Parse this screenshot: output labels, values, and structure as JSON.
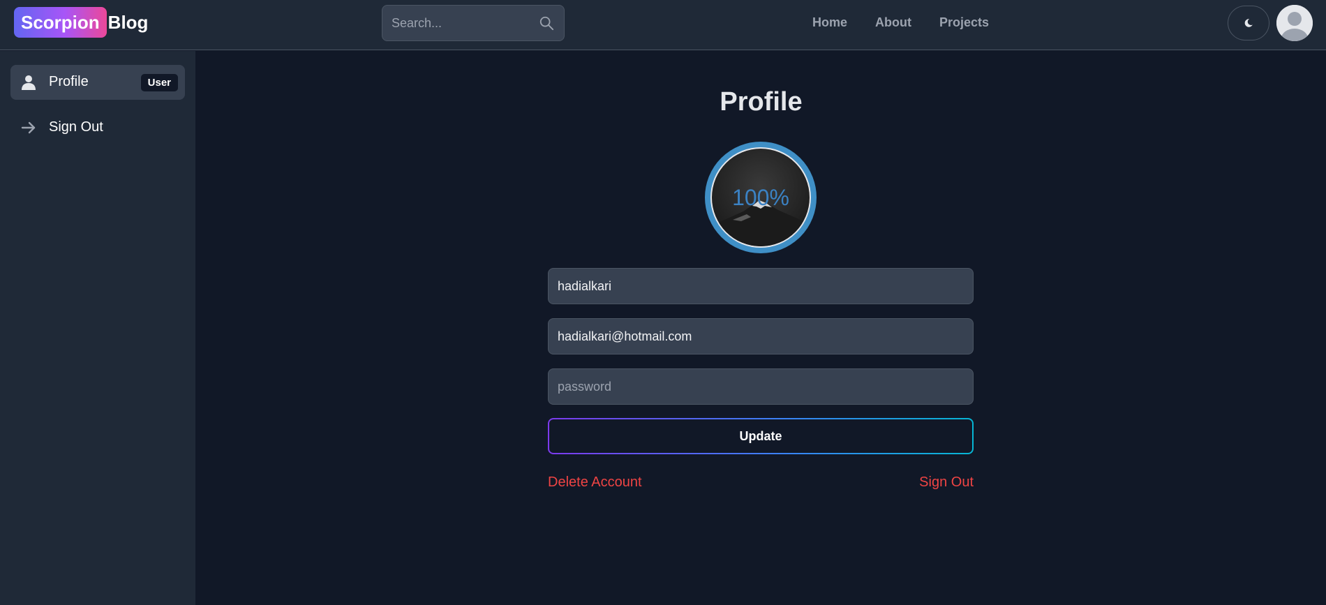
{
  "header": {
    "logo_chip": "Scorpion",
    "logo_rest": "Blog",
    "search_placeholder": "Search...",
    "nav": [
      "Home",
      "About",
      "Projects"
    ]
  },
  "sidebar": {
    "items": [
      {
        "label": "Profile",
        "badge": "User",
        "icon": "user-icon",
        "active": true
      },
      {
        "label": "Sign Out",
        "icon": "arrow-right-icon",
        "active": false
      }
    ]
  },
  "main": {
    "title": "Profile",
    "upload_progress_label": "100%",
    "upload_progress": 1.0,
    "username_value": "hadialkari",
    "email_value": "hadialkari@hotmail.com",
    "password_placeholder": "password",
    "update_label": "Update",
    "delete_label": "Delete Account",
    "signout_label": "Sign Out"
  },
  "colors": {
    "accent_ring": "#3f8fc6",
    "danger": "#ef4444",
    "background": "#111827",
    "panel": "#1f2937"
  }
}
